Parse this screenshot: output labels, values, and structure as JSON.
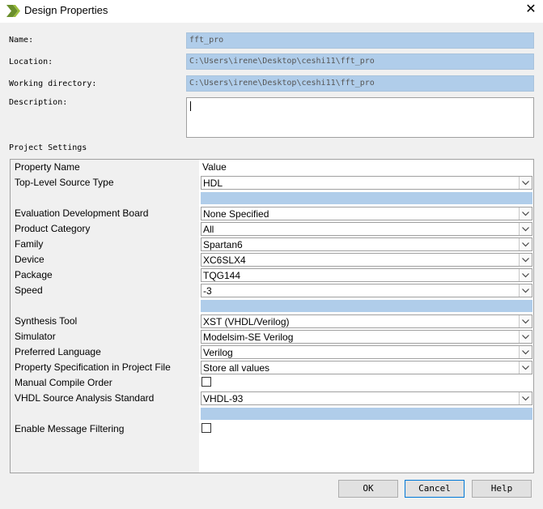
{
  "window": {
    "title": "Design Properties",
    "close": "✕"
  },
  "form": {
    "name_label": "Name:",
    "name_value": "fft_pro",
    "location_label": "Location:",
    "location_value": "C:\\Users\\irene\\Desktop\\ceshi11\\fft_pro",
    "workdir_label": "Working directory:",
    "workdir_value": "C:\\Users\\irene\\Desktop\\ceshi11\\fft_pro",
    "description_label": "Description:",
    "description_value": ""
  },
  "settings": {
    "section_label": "Project Settings",
    "header": {
      "name": "Property Name",
      "value": "Value"
    },
    "rows": [
      {
        "name": "Top-Level Source Type",
        "value": "HDL"
      },
      {
        "name": "Evaluation Development Board",
        "value": "None Specified"
      },
      {
        "name": "Product Category",
        "value": "All"
      },
      {
        "name": "Family",
        "value": "Spartan6"
      },
      {
        "name": "Device",
        "value": "XC6SLX4"
      },
      {
        "name": "Package",
        "value": "TQG144"
      },
      {
        "name": "Speed",
        "value": "-3"
      },
      {
        "name": "Synthesis Tool",
        "value": "XST (VHDL/Verilog)"
      },
      {
        "name": "Simulator",
        "value": "Modelsim-SE Verilog"
      },
      {
        "name": "Preferred Language",
        "value": "Verilog"
      },
      {
        "name": "Property Specification in Project File",
        "value": "Store all values"
      },
      {
        "name": "Manual Compile Order",
        "checked": false
      },
      {
        "name": "VHDL Source Analysis Standard",
        "value": "VHDL-93"
      },
      {
        "name": "Enable Message Filtering",
        "checked": false
      }
    ]
  },
  "buttons": {
    "ok": "OK",
    "cancel": "Cancel",
    "help": "Help"
  },
  "colors": {
    "field_bg": "#b0cdea",
    "dialog_bg": "#f0f0f0",
    "accent": "#0078d7"
  }
}
